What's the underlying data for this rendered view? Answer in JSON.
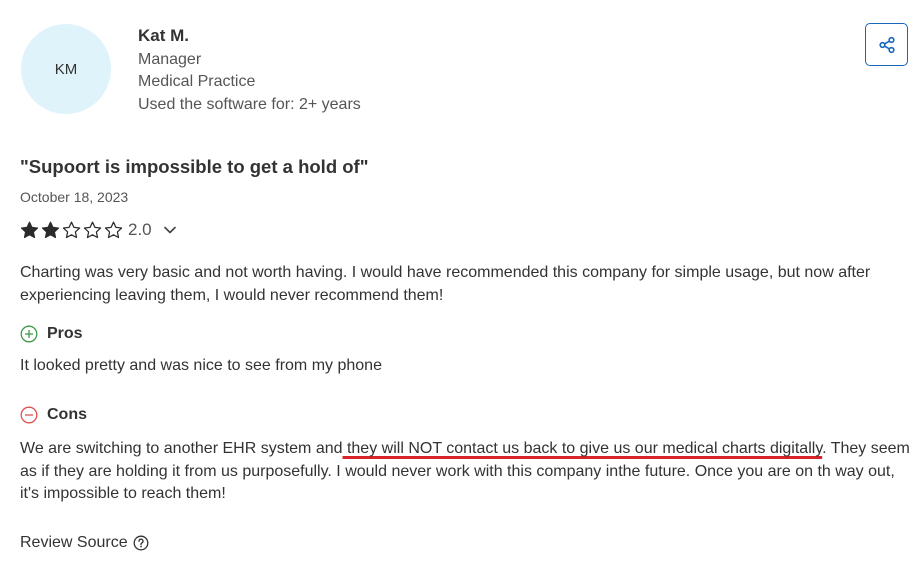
{
  "reviewer": {
    "initials": "KM",
    "name": "Kat M.",
    "role": "Manager",
    "industry": "Medical Practice",
    "usage": "Used the software for: 2+ years"
  },
  "review": {
    "title": "\"Supoort is impossible to get a hold of\"",
    "date": "October 18, 2023",
    "rating": 2,
    "rating_text": "2.0",
    "summary": "Charting was very basic and not worth having. I would have recommended this company for simple usage, but now after experiencing leaving them, I would never recommend them!",
    "pros_label": "Pros",
    "pros_text": "It looked pretty and was nice to see from my phone",
    "cons_label": "Cons",
    "cons_text_before": "We are switching to another EHR system and",
    "cons_text_highlight": " they will NOT contact us back to give us our medical charts digitally",
    "cons_text_after": ". They seem as if they are holding it from us purposefully. I would never work with this company inthe future. Once you are on th way out, it's impossible to reach them!"
  },
  "footer": {
    "review_source_label": "Review Source"
  },
  "icons": {
    "share": "share-icon",
    "star_filled": "star-filled-icon",
    "star_empty": "star-empty-icon",
    "chevron": "chevron-down-icon",
    "pros": "plus-circle-icon",
    "cons": "minus-circle-icon",
    "help": "question-circle-icon"
  },
  "colors": {
    "avatar_bg": "#dff3fb",
    "accent": "#1a66b8",
    "pros_green": "#3d9a4b",
    "cons_red": "#d9534f",
    "highlight_underline": "#d8232a"
  }
}
